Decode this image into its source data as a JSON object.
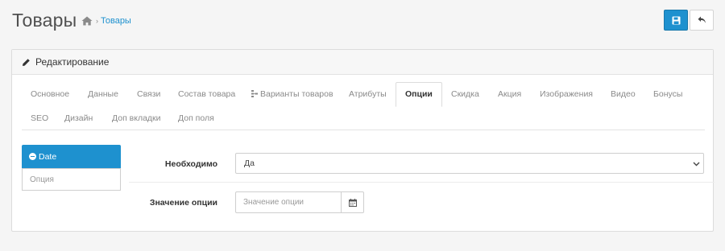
{
  "header": {
    "title": "Товары",
    "breadcrumb": {
      "separator": "›",
      "current": "Товары"
    }
  },
  "actions": {
    "save_icon": "save-icon",
    "back_icon": "reply-icon"
  },
  "panel": {
    "heading": "Редактирование",
    "tabs": [
      {
        "label": "Основное"
      },
      {
        "label": "Данные"
      },
      {
        "label": "Связи"
      },
      {
        "label": "Состав товара"
      },
      {
        "label": "Варианты товаров"
      },
      {
        "label": "Атрибуты"
      },
      {
        "label": "Опции"
      },
      {
        "label": "Скидка"
      },
      {
        "label": "Акция"
      },
      {
        "label": "Изображения"
      },
      {
        "label": "Видео"
      },
      {
        "label": "Бонусы"
      },
      {
        "label": "SEO"
      },
      {
        "label": "Дизайн"
      },
      {
        "label": "Доп вкладки"
      },
      {
        "label": "Доп поля"
      }
    ],
    "active_tab": "Опции"
  },
  "options": {
    "selected": "Date",
    "add_placeholder": "Опция"
  },
  "form": {
    "required_label": "Необходимо",
    "required_value": "Да",
    "value_label": "Значение опции",
    "value_placeholder": "Значение опции"
  },
  "colors": {
    "primary": "#1e91cf",
    "background": "#f5f5f5"
  }
}
